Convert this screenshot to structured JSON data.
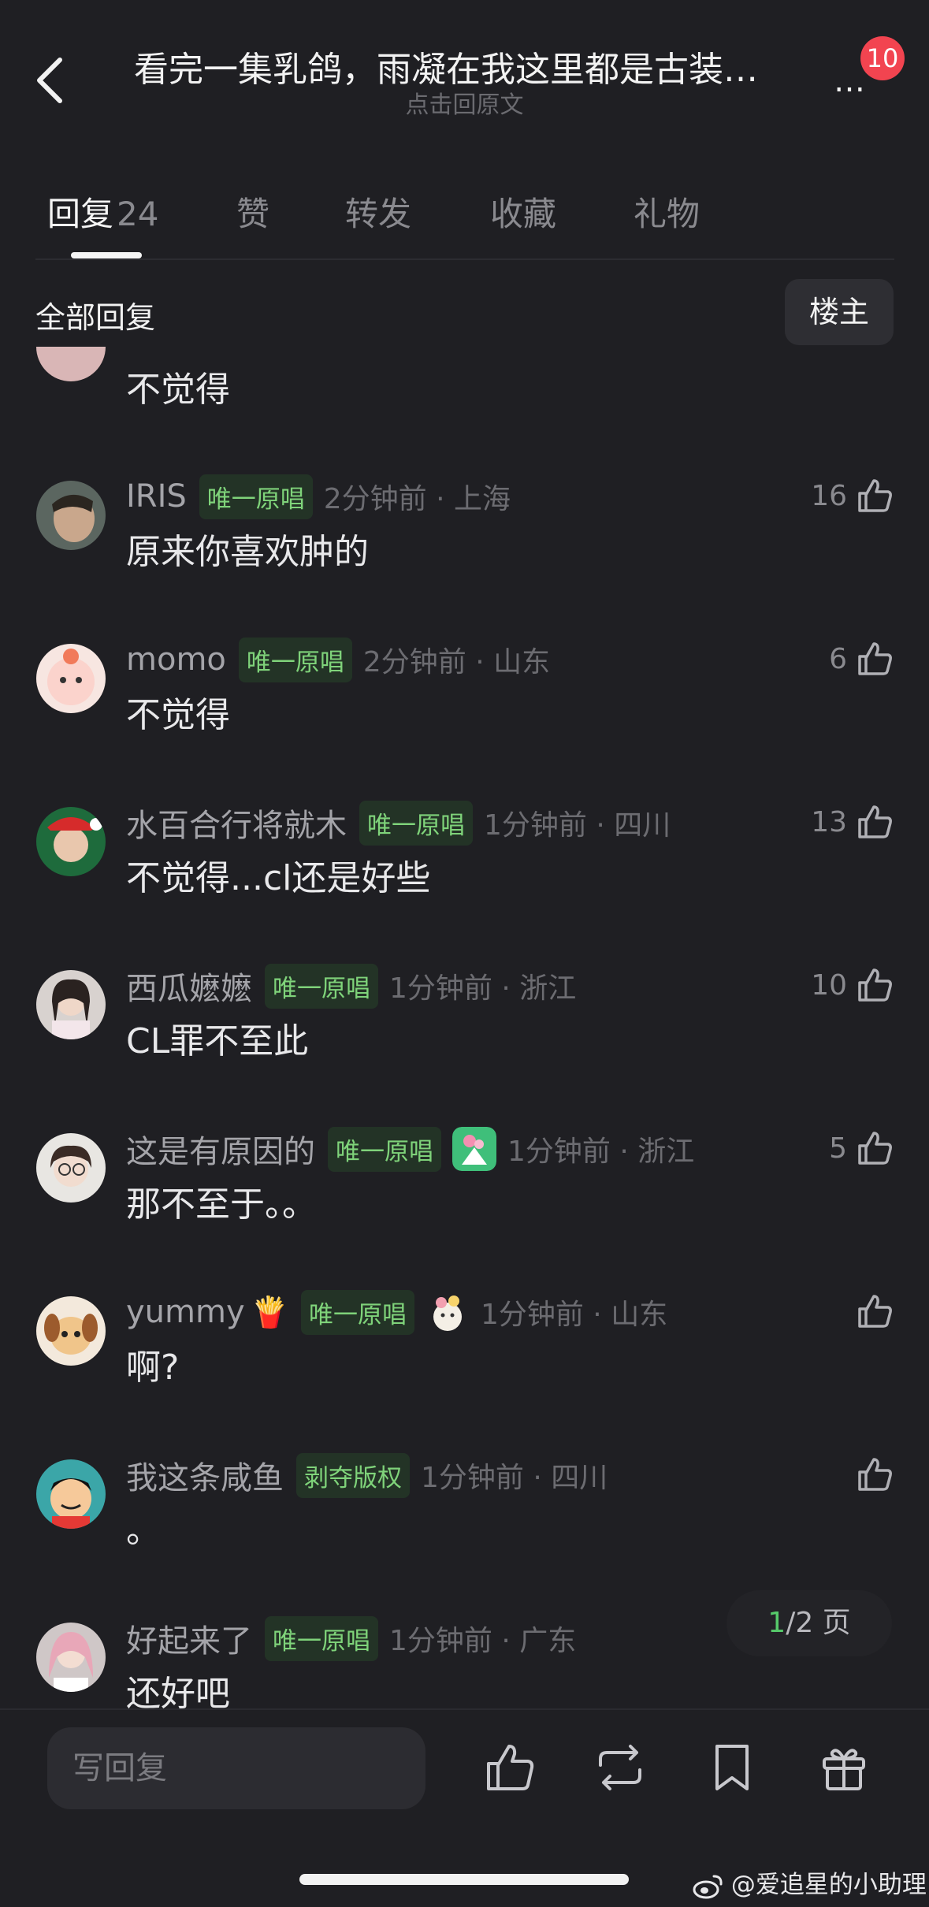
{
  "header": {
    "title": "看完一集乳鸽，雨凝在我这里都是古装…",
    "subtitle": "点击回原文",
    "more_label": "…",
    "notification_count": "10"
  },
  "tabs": [
    {
      "label": "回复",
      "count": "24"
    },
    {
      "label": "赞"
    },
    {
      "label": "转发"
    },
    {
      "label": "收藏"
    },
    {
      "label": "礼物"
    }
  ],
  "filter": {
    "all_replies": "全部回复",
    "host_only": "楼主"
  },
  "first_comment_text": "不觉得",
  "comments": [
    {
      "user": "IRIS",
      "tag": "唯一原唱",
      "time": "2分钟前 · 上海",
      "text": "原来你喜欢肿的",
      "likes": "16"
    },
    {
      "user": "momo",
      "tag": "唯一原唱",
      "time": "2分钟前 · 山东",
      "text": "不觉得",
      "likes": "6"
    },
    {
      "user": "水百合行将就木",
      "tag": "唯一原唱",
      "time": "1分钟前 · 四川",
      "text": "不觉得...cl还是好些",
      "likes": "13"
    },
    {
      "user": "西瓜嬷嬷",
      "tag": "唯一原唱",
      "time": "1分钟前 · 浙江",
      "text": "CL罪不至此",
      "likes": "10"
    },
    {
      "user": "这是有原因的",
      "tag": "唯一原唱",
      "time": "1分钟前 · 浙江",
      "text": "那不至于。。",
      "likes": "5"
    },
    {
      "user": "yummy",
      "emoji": "🍟",
      "tag": "唯一原唱",
      "time": "1分钟前 · 山东",
      "text": "啊?",
      "likes": ""
    },
    {
      "user": "我这条咸鱼",
      "tag": "剥夺版权",
      "time": "1分钟前 · 四川",
      "text": "。",
      "likes": ""
    },
    {
      "user": "好起来了",
      "tag": "唯一原唱",
      "time": "1分钟前 · 广东",
      "text": "还好吧",
      "likes": ""
    }
  ],
  "pager": {
    "current": "1",
    "rest": "/2 页"
  },
  "bottom": {
    "reply_placeholder": "写回复"
  },
  "watermark": "@爱追星的小助理",
  "colors": {
    "background": "#1f1f23",
    "tag_green": "#7fd37a",
    "badge_red": "#f24450",
    "pager_green": "#56c96a"
  }
}
